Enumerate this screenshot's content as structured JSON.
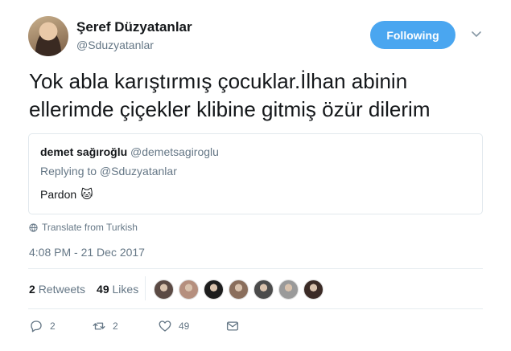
{
  "author": {
    "name": "Şeref Düzyatanlar",
    "handle": "@Sduzyatanlar"
  },
  "follow_button": {
    "label": "Following"
  },
  "tweet": {
    "text_line1": "Yok abla karıştırmış çocuklar.İlhan abinin",
    "text_line2": "ellerimde çiçekler klibine gitmiş özür dilerim"
  },
  "quoted_tweet": {
    "name": "demet sağıroğlu",
    "handle": "@demetsagiroglu",
    "replying_to": "Replying to @Sduzyatanlar",
    "text": "Pardon",
    "emoji": "🐱"
  },
  "translate": {
    "label": "Translate from Turkish"
  },
  "timestamp": "4:08 PM - 21 Dec 2017",
  "stats": {
    "retweets_count": "2",
    "retweets_label": "Retweets",
    "likes_count": "49",
    "likes_label": "Likes"
  },
  "likers": [
    "#5b4a44",
    "#b58f7e",
    "#1d1d1d",
    "#8a6e5c",
    "#4b4b4b",
    "#9a9a9a",
    "#3b2b26"
  ],
  "actions": {
    "reply_count": "2",
    "retweet_count": "2",
    "like_count": "49"
  },
  "colors": {
    "accent": "#4aa6f0",
    "muted": "#657786",
    "text": "#14171a",
    "border": "#e1e8ed"
  }
}
